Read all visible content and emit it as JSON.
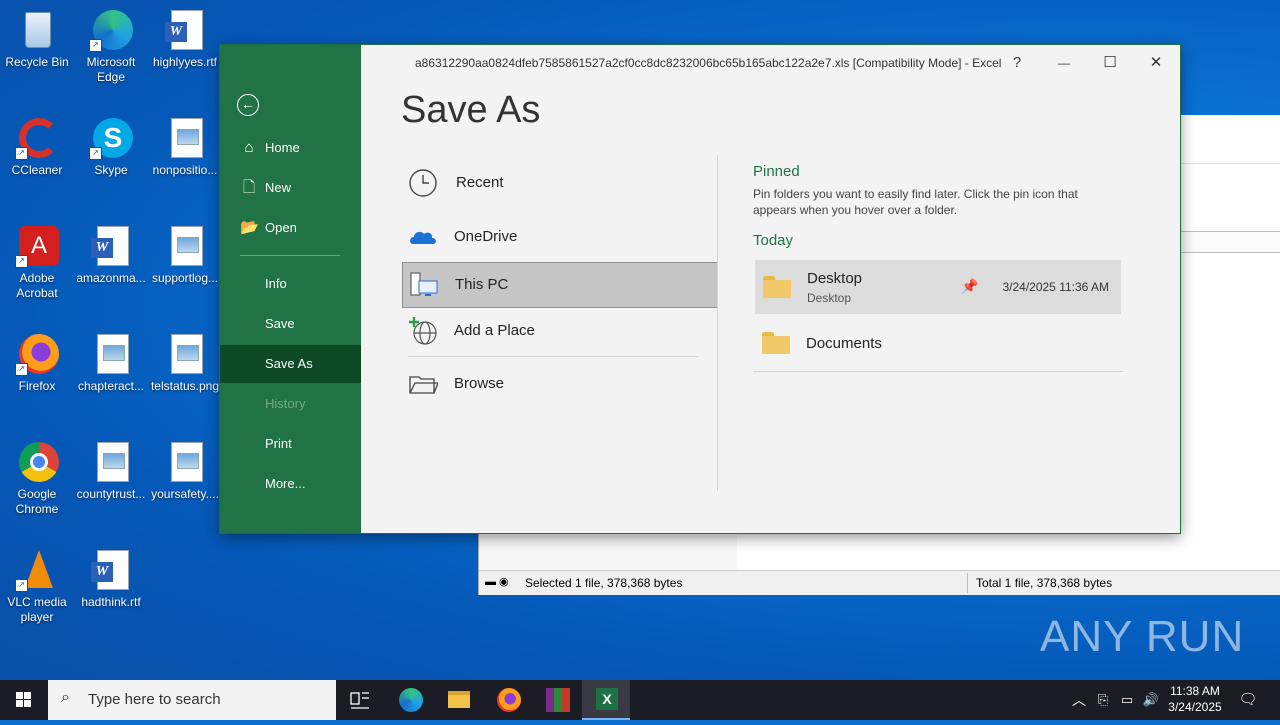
{
  "desktop": {
    "icons": [
      {
        "label": "Recycle Bin"
      },
      {
        "label": "Microsoft Edge"
      },
      {
        "label": "highlyyes.rtf"
      },
      {
        "label": "CCleaner"
      },
      {
        "label": "Skype"
      },
      {
        "label": "nonpositio..."
      },
      {
        "label": "Adobe Acrobat"
      },
      {
        "label": "amazonma..."
      },
      {
        "label": "supportlog..."
      },
      {
        "label": "Firefox"
      },
      {
        "label": "chapteract..."
      },
      {
        "label": "telstatus.png"
      },
      {
        "label": "Google Chrome"
      },
      {
        "label": "countytrust..."
      },
      {
        "label": "yoursafety...."
      },
      {
        "label": "VLC media player"
      },
      {
        "label": "hadthink.rtf"
      }
    ],
    "watermark": "ANY RUN"
  },
  "explorer": {
    "status_selected": "Selected 1 file, 378,368 bytes",
    "status_total": "Total 1 file, 378,368 bytes"
  },
  "excel": {
    "title": "a86312290aa0824dfeb7585861527a2cf0cc8dc8232006bc65b165abc122a2e7.xls  [Compatibility Mode]  -  Excel",
    "help": "?",
    "minimize": "—",
    "maximize": "☐",
    "close": "✕",
    "backstage": {
      "back": "←",
      "items": [
        {
          "label": "Home",
          "icon": "⌂"
        },
        {
          "label": "New",
          "icon": "🗋"
        },
        {
          "label": "Open",
          "icon": "📂"
        },
        {
          "label": "Info"
        },
        {
          "label": "Save"
        },
        {
          "label": "Save As"
        },
        {
          "label": "History"
        },
        {
          "label": "Print"
        },
        {
          "label": "More..."
        }
      ]
    },
    "page_title": "Save As",
    "locations": [
      {
        "label": "Recent"
      },
      {
        "label": "OneDrive"
      },
      {
        "label": "This PC"
      },
      {
        "label": "Add a Place"
      },
      {
        "label": "Browse"
      }
    ],
    "pinned_heading": "Pinned",
    "pinned_desc": "Pin folders you want to easily find later. Click the pin icon that appears when you hover over a folder.",
    "today_heading": "Today",
    "folders": [
      {
        "name": "Desktop",
        "sub": "Desktop",
        "date": "3/24/2025 11:36 AM"
      },
      {
        "name": "Documents"
      }
    ]
  },
  "taskbar": {
    "search_placeholder": "Type here to search",
    "time": "11:38 AM",
    "date": "3/24/2025"
  }
}
